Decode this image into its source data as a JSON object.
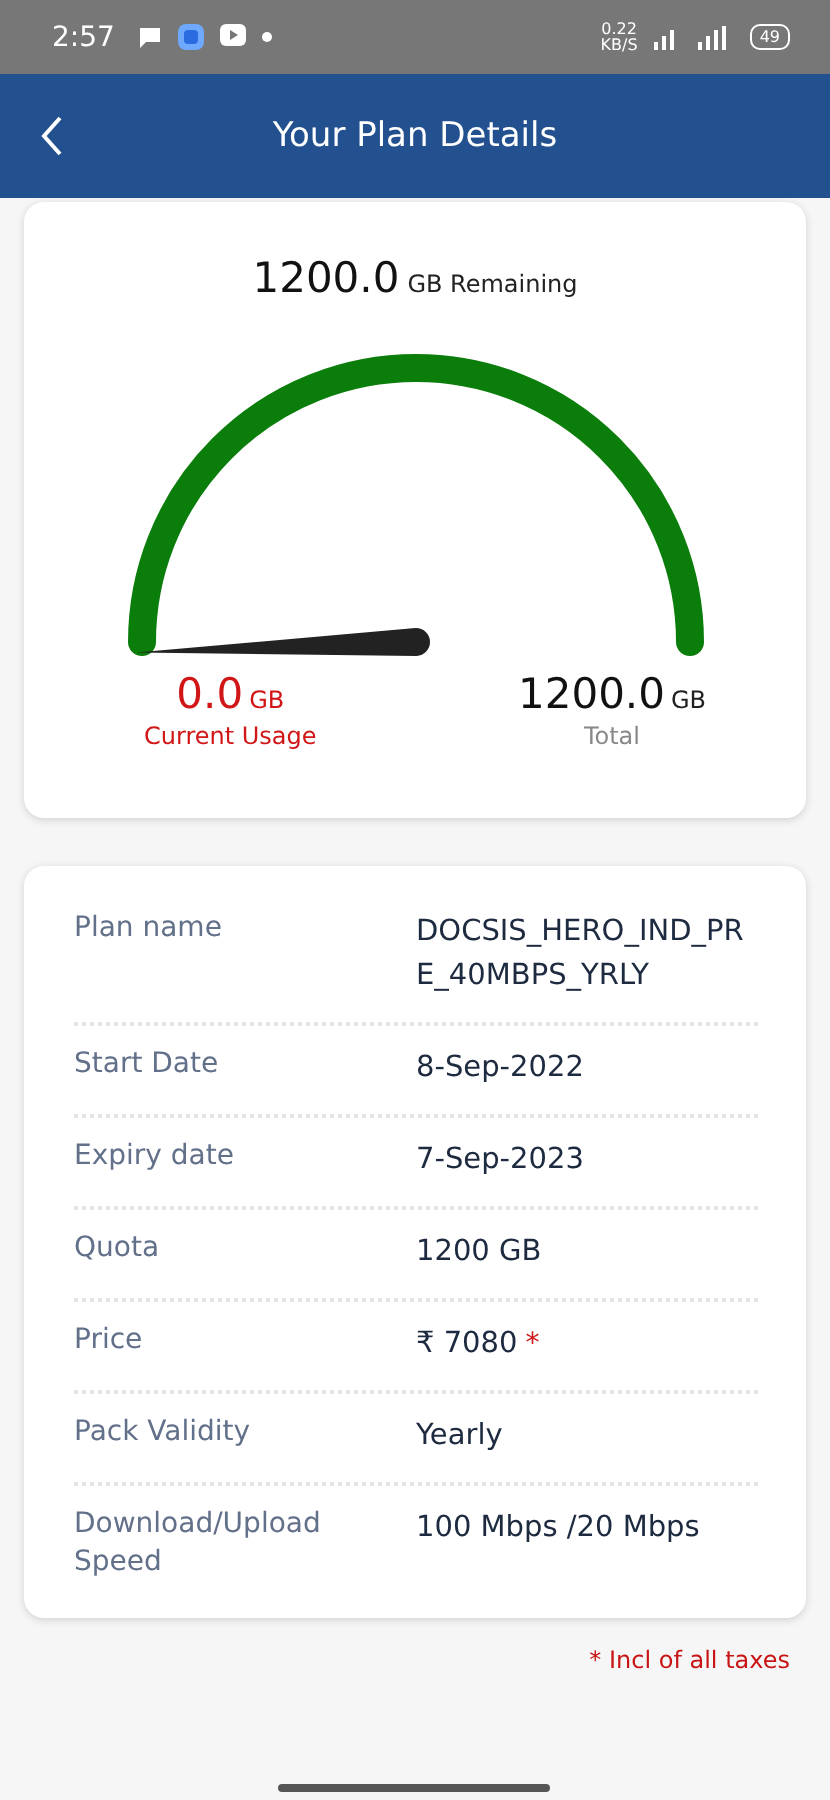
{
  "status_bar": {
    "time": "2:57",
    "net_speed": "0.22",
    "net_unit": "KB/S",
    "battery": "49"
  },
  "header": {
    "title": "Your Plan Details"
  },
  "usage": {
    "remaining_value": "1200.0",
    "remaining_unit": "GB Remaining",
    "current": {
      "value": "0.0",
      "unit": "GB",
      "label": "Current Usage"
    },
    "total": {
      "value": "1200.0",
      "unit": "GB",
      "label": "Total"
    }
  },
  "details": [
    {
      "label": "Plan name",
      "value": "DOCSIS_HERO_IND_PRE_40MBPS_YRLY"
    },
    {
      "label": "Start Date",
      "value": "8-Sep-2022"
    },
    {
      "label": "Expiry date",
      "value": "7-Sep-2023"
    },
    {
      "label": "Quota",
      "value": "1200 GB"
    },
    {
      "label": "Price",
      "value": "₹ 7080",
      "mark": "*"
    },
    {
      "label": "Pack Validity",
      "value": "Yearly"
    },
    {
      "label": "Download/Upload Speed",
      "value": "100 Mbps /20 Mbps"
    }
  ],
  "footnote": "* Incl of all taxes"
}
